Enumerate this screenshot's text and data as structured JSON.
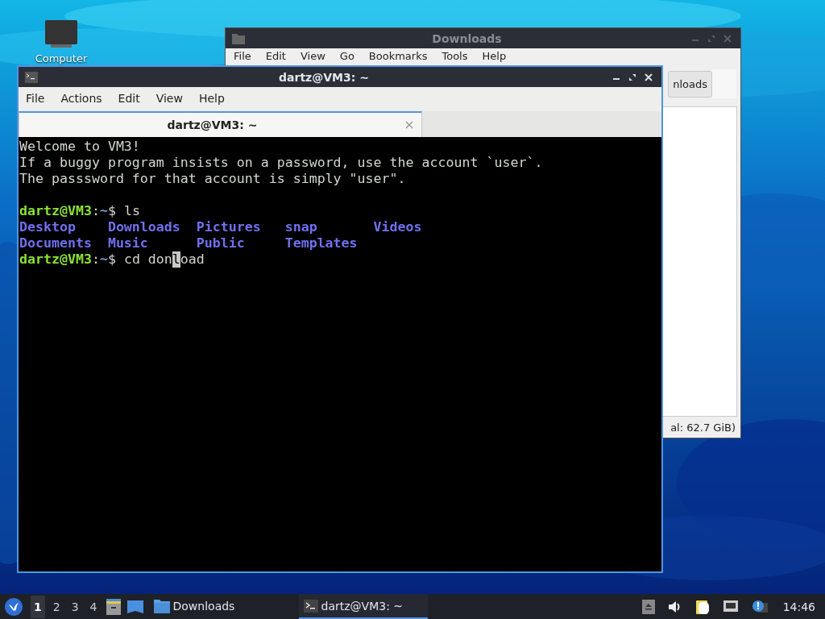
{
  "desktop": {
    "icons": [
      {
        "label": "Computer"
      }
    ]
  },
  "file_manager": {
    "title": "Downloads",
    "active": false,
    "menu": [
      "File",
      "Edit",
      "View",
      "Go",
      "Bookmarks",
      "Tools",
      "Help"
    ],
    "path_button": "nloads",
    "status": "al: 62.7 GiB)"
  },
  "terminal": {
    "title": "dartz@VM3: ~",
    "active": true,
    "menu": [
      "File",
      "Actions",
      "Edit",
      "View",
      "Help"
    ],
    "tabs": [
      {
        "label": "dartz@VM3: ~",
        "selected": true
      }
    ],
    "lines": [
      {
        "kind": "text",
        "text": "Welcome to VM3!"
      },
      {
        "kind": "text",
        "text": "If a buggy program insists on a password, use the account `user`."
      },
      {
        "kind": "text",
        "text": "The passsword for that account is simply \"user\"."
      },
      {
        "kind": "blank"
      },
      {
        "kind": "prompt",
        "user": "dartz@VM3",
        "colon": ":",
        "dir": "~",
        "sign": "$",
        "command": "ls"
      },
      {
        "kind": "listing",
        "items": [
          "Desktop",
          "Downloads",
          "Pictures",
          "snap",
          "Videos"
        ]
      },
      {
        "kind": "listing",
        "items": [
          "Documents",
          "Music",
          "Public",
          "Templates"
        ]
      },
      {
        "kind": "prompt",
        "user": "dartz@VM3",
        "colon": ":",
        "dir": "~",
        "sign": "$",
        "command": "cd don",
        "cursor": "l",
        "after_cursor": "oad"
      }
    ]
  },
  "taskbar": {
    "workspaces": [
      {
        "label": "1",
        "selected": true
      },
      {
        "label": "2",
        "selected": false
      },
      {
        "label": "3",
        "selected": false
      },
      {
        "label": "4",
        "selected": false
      }
    ],
    "tasks": [
      {
        "kind": "folder",
        "label": "Downloads",
        "selected": false
      },
      {
        "kind": "terminal",
        "label": "dartz@VM3: ~",
        "selected": true
      }
    ],
    "clock": "14:46"
  }
}
